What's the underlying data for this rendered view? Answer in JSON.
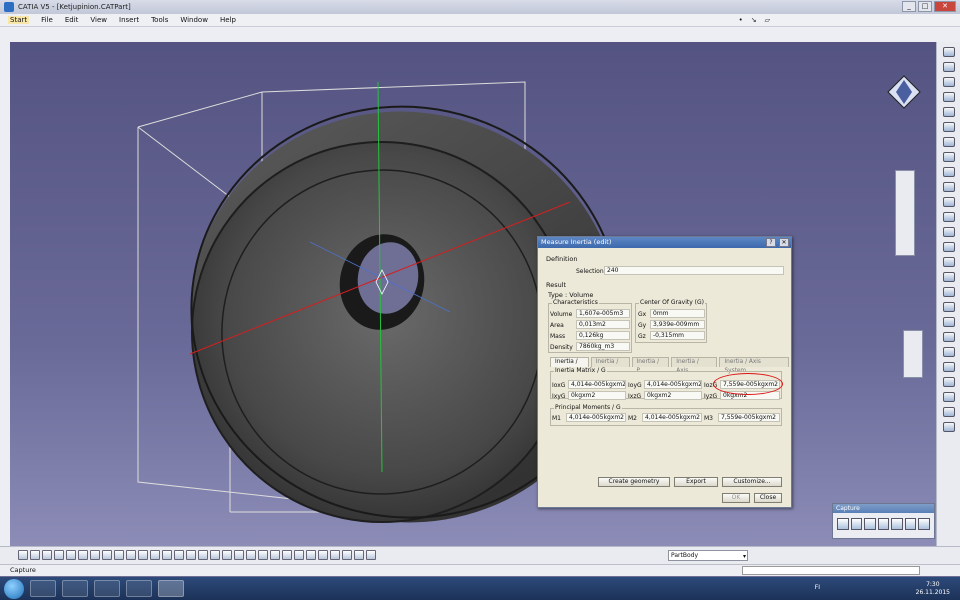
{
  "window": {
    "title": "CATIA V5 - [Ketjupinion.CATPart]"
  },
  "menu": [
    "Start",
    "File",
    "Edit",
    "View",
    "Insert",
    "Tools",
    "Window",
    "Help"
  ],
  "dialog": {
    "title": "Measure Inertia (edit)",
    "definition_label": "Definition",
    "selection_label": "Selection :",
    "selection_value": "240",
    "result_label": "Result",
    "type_label": "Type : Volume",
    "characteristics_label": "Characteristics",
    "cog_label": "Center Of Gravity (G)",
    "volume_label": "Volume",
    "volume_value": "1,607e-005m3",
    "area_label": "Area",
    "area_value": "0,013m2",
    "mass_label": "Mass",
    "mass_value": "0,126kg",
    "density_label": "Density",
    "density_value": "7860kg_m3",
    "gx_label": "Gx",
    "gx_value": "0mm",
    "gy_label": "Gy",
    "gy_value": "3,939e-009mm",
    "gz_label": "Gz",
    "gz_value": "-0,315mm",
    "tabs": [
      "Inertia / G",
      "Inertia / O",
      "Inertia / P",
      "Inertia / Axis",
      "Inertia / Axis System"
    ],
    "matrix_label": "Inertia Matrix / G",
    "ioxg_label": "IoxG",
    "ioxg_value": "4,014e-005kgxm2",
    "ioyg_label": "IoyG",
    "ioyg_value": "4,014e-005kgxm2",
    "iozg_label": "IozG",
    "iozg_value": "7,559e-005kgxm2",
    "ixyg_label": "IxyG",
    "ixyg_value": "0kgxm2",
    "ixzg_label": "IxzG",
    "ixzg_value": "0kgxm2",
    "iyzg_label": "IyzG",
    "iyzg_value": "0kgxm2",
    "principal_label": "Principal Moments / G",
    "m1_label": "M1",
    "m1_value": "4,014e-005kgxm2",
    "m2_label": "M2",
    "m2_value": "4,014e-005kgxm2",
    "m3_label": "M3",
    "m3_value": "7,559e-005kgxm2",
    "create_geometry": "Create geometry",
    "export": "Export",
    "customize": "Customize...",
    "ok": "OK",
    "close": "Close"
  },
  "capture_panel": {
    "title": "Capture"
  },
  "status": {
    "text": "Capture"
  },
  "partbody": "PartBody",
  "taskbar": {
    "lang": "FI",
    "time": "7:30",
    "date": "26.11.2015"
  },
  "colors": {
    "viewport_top": "#545381",
    "viewport_bottom": "#8c8cb7",
    "highlight": "#d11111"
  }
}
